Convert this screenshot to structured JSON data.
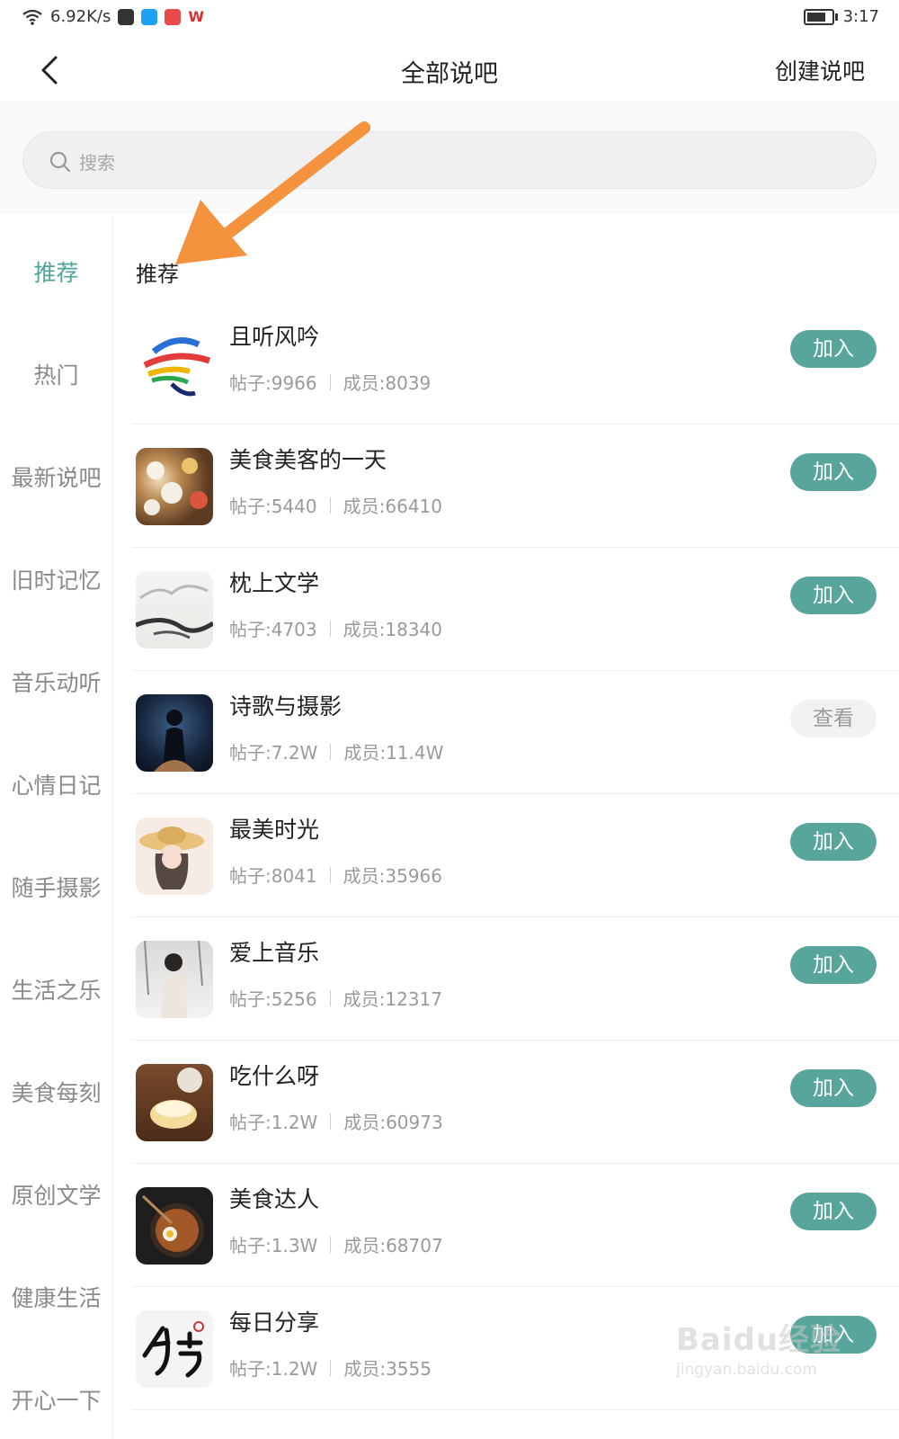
{
  "status": {
    "network_speed": "6.92K/s",
    "time": "3:17"
  },
  "nav": {
    "title": "全部说吧",
    "create": "创建说吧"
  },
  "search": {
    "placeholder": "搜索"
  },
  "sidebar": {
    "items": [
      {
        "label": "推荐",
        "active": true
      },
      {
        "label": "热门"
      },
      {
        "label": "最新说吧"
      },
      {
        "label": "旧时记忆"
      },
      {
        "label": "音乐动听"
      },
      {
        "label": "心情日记"
      },
      {
        "label": "随手摄影"
      },
      {
        "label": "生活之乐"
      },
      {
        "label": "美食每刻"
      },
      {
        "label": "原创文学"
      },
      {
        "label": "健康生活"
      },
      {
        "label": "开心一下"
      }
    ]
  },
  "main": {
    "section_title": "推荐",
    "groups": [
      {
        "name": "且听风吟",
        "posts": "帖子:9966",
        "members": "成员:8039",
        "button": "加入",
        "joined": false
      },
      {
        "name": "美食美客的一天",
        "posts": "帖子:5440",
        "members": "成员:66410",
        "button": "加入",
        "joined": false
      },
      {
        "name": "枕上文学",
        "posts": "帖子:4703",
        "members": "成员:18340",
        "button": "加入",
        "joined": false
      },
      {
        "name": "诗歌与摄影",
        "posts": "帖子:7.2W",
        "members": "成员:11.4W",
        "button": "查看",
        "joined": true
      },
      {
        "name": "最美时光",
        "posts": "帖子:8041",
        "members": "成员:35966",
        "button": "加入",
        "joined": false
      },
      {
        "name": "爱上音乐",
        "posts": "帖子:5256",
        "members": "成员:12317",
        "button": "加入",
        "joined": false
      },
      {
        "name": "吃什么呀",
        "posts": "帖子:1.2W",
        "members": "成员:60973",
        "button": "加入",
        "joined": false
      },
      {
        "name": "美食达人",
        "posts": "帖子:1.3W",
        "members": "成员:68707",
        "button": "加入",
        "joined": false
      },
      {
        "name": "每日分享",
        "posts": "帖子:1.2W",
        "members": "成员:3555",
        "button": "加入",
        "joined": false
      }
    ]
  },
  "watermark": {
    "line1": "Baidu经验",
    "line2": "jingyan.baidu.com"
  },
  "colors": {
    "accent": "#57a59b",
    "accent_text": "#4fa397",
    "arrow": "#f5923e"
  },
  "icons": [
    "wifi-icon",
    "back-icon",
    "search-icon",
    "annotation-arrow",
    "battery-icon"
  ]
}
